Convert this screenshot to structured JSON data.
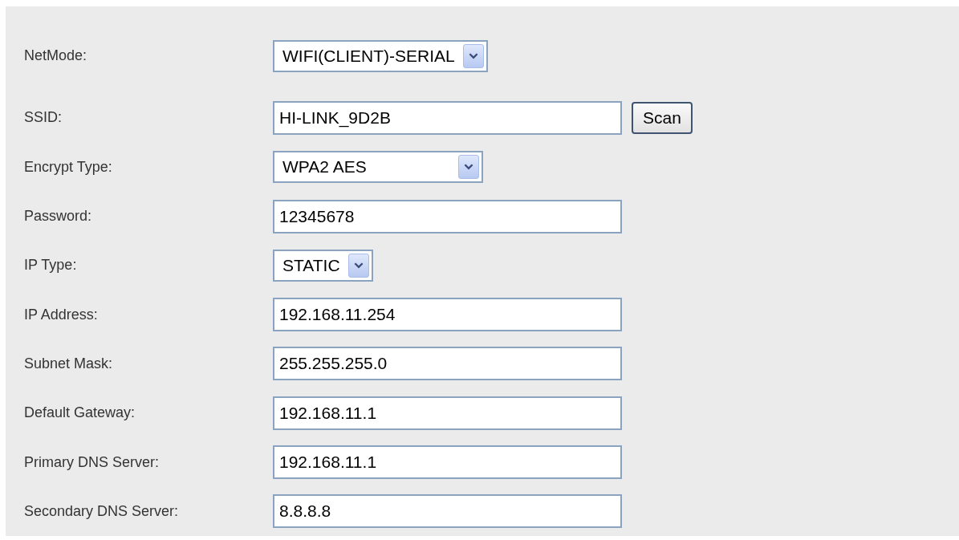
{
  "fields": [
    {
      "kind": "select",
      "label": "NetMode:",
      "value": "WIFI(CLIENT)-SERIAL"
    },
    {
      "kind": "text_button",
      "label": "SSID:",
      "value": "HI-LINK_9D2B",
      "button": "Scan"
    },
    {
      "kind": "select",
      "label": "Encrypt Type:",
      "value": "WPA2 AES"
    },
    {
      "kind": "text",
      "label": "Password:",
      "value": "12345678"
    },
    {
      "kind": "select",
      "label": "IP Type:",
      "value": "STATIC"
    },
    {
      "kind": "text",
      "label": "IP Address:",
      "value": "192.168.11.254"
    },
    {
      "kind": "text",
      "label": "Subnet Mask:",
      "value": "255.255.255.0"
    },
    {
      "kind": "text",
      "label": "Default Gateway:",
      "value": "192.168.11.1"
    },
    {
      "kind": "text",
      "label": "Primary DNS Server:",
      "value": "192.168.11.1"
    },
    {
      "kind": "text",
      "label": "Secondary DNS Server:",
      "value": "8.8.8.8"
    }
  ]
}
